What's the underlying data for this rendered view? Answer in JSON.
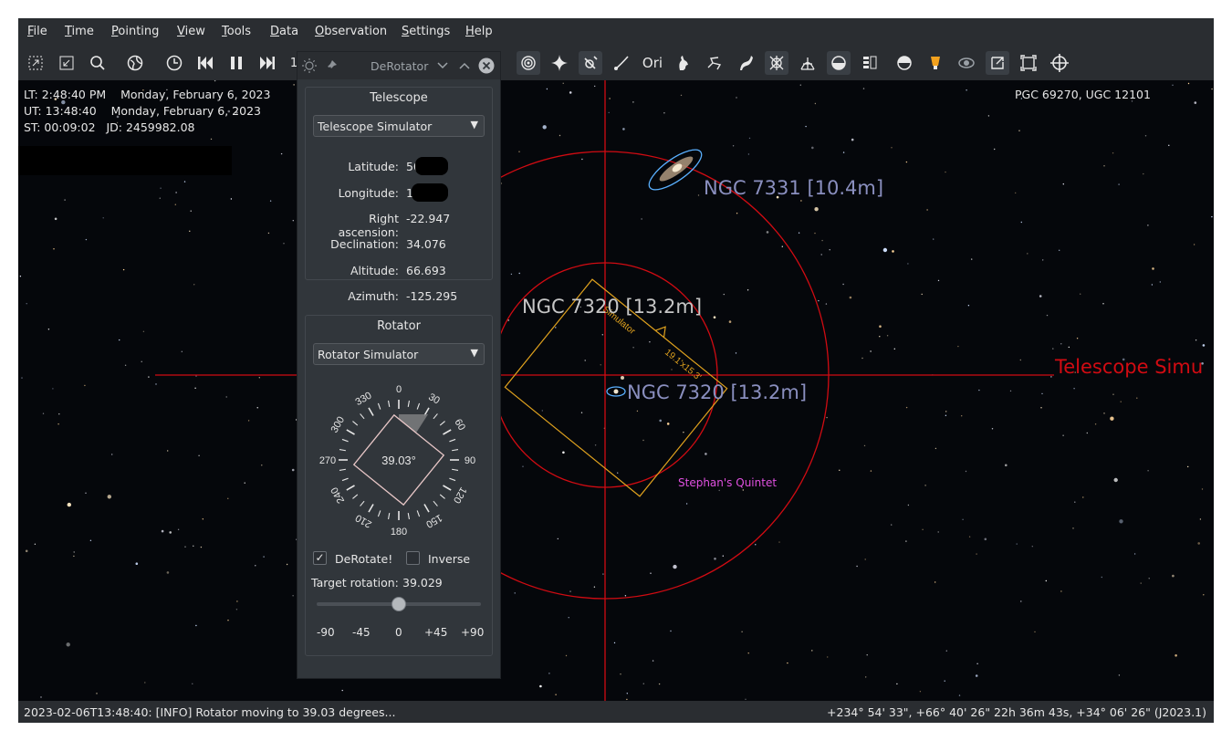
{
  "menu": [
    "File",
    "Time",
    "Pointing",
    "View",
    "Tools",
    "Data",
    "Observation",
    "Settings",
    "Help"
  ],
  "menu_underline": [
    "F",
    "T",
    "P",
    "V",
    "T",
    "D",
    "O",
    "S",
    "H"
  ],
  "menu_rest": [
    "ile",
    "ime",
    "ointing",
    "iew",
    "ools",
    "ata",
    "bservation",
    "ettings",
    "elp"
  ],
  "toolbar": {
    "step_value": "1"
  },
  "info": {
    "lt": "LT: 2:48:40 PM    Monday, February 6, 2023",
    "ut": "UT: 13:48:40    Monday, February 6, 2023",
    "st": "ST: 00:09:02   JD: 2459982.08",
    "object": "PGC 69270, UGC 12101"
  },
  "sky": {
    "ngc7331": "NGC 7331 [10.4m]",
    "ngc7320_top": "NGC 7320 [13.2m]",
    "ngc7320_center": "NGC 7320 [13.2m]",
    "telescope": "Telescope Simu",
    "quintet": "Stephan's Quintet",
    "fov_name": "Simulator",
    "fov_size": "19.1'x15.3'"
  },
  "panel": {
    "title": "DeRotator",
    "telescope_group": "Telescope",
    "telescope_device": "Telescope Simulator",
    "rows": [
      {
        "label": "Latitude:",
        "value": "50"
      },
      {
        "label": "Longitude:",
        "value": "1"
      },
      {
        "label": "Right ascension:",
        "value": "-22.947"
      },
      {
        "label": "Declination:",
        "value": "34.076"
      },
      {
        "label": "Altitude:",
        "value": "66.693"
      },
      {
        "label": "Azimuth:",
        "value": "-125.295"
      }
    ],
    "rotator_group": "Rotator",
    "rotator_device": "Rotator Simulator",
    "dial_ticks": [
      "0",
      "30",
      "60",
      "90",
      "120",
      "150",
      "180",
      "210",
      "240",
      "270",
      "300",
      "330"
    ],
    "dial_value": "39.03°",
    "derotate_label": "DeRotate!",
    "derotate_checked": true,
    "inverse_label": "Inverse",
    "inverse_checked": false,
    "target_label": "Target rotation:",
    "target_value": "39.029",
    "slider_value": 0,
    "slider_min": -90,
    "slider_max": 90,
    "slider_labels": [
      "-90",
      "-45",
      "0",
      "+45",
      "+90"
    ]
  },
  "status": {
    "message": "2023-02-06T13:48:40: [INFO] Rotator moving to 39.03 degrees...",
    "coords": "+234° 54' 33\", +66° 40' 26\"  22h 36m 43s, +34° 06' 26\" (J2023.1)"
  },
  "colors": {
    "accent_red": "#d10b12",
    "fov_orange": "#e0a21e",
    "label_gray": "#8a8fbf",
    "quintet": "#e050e0"
  }
}
